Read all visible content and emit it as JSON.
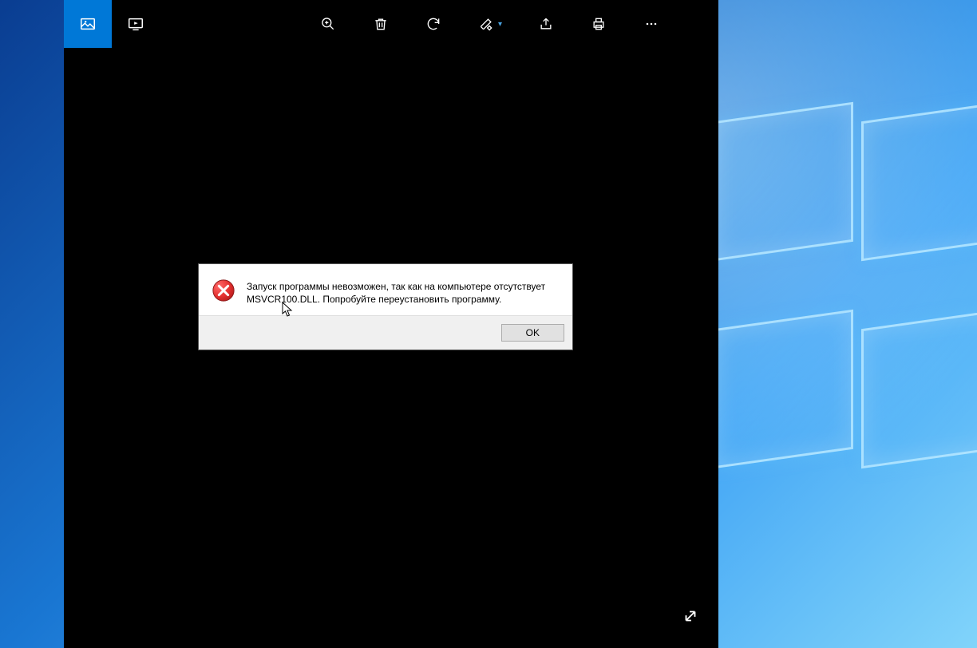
{
  "dialog": {
    "message": "Запуск программы невозможен, так как на компьютере отсутствует MSVCR100.DLL. Попробуйте переустановить программу.",
    "ok_label": "OK"
  },
  "toolbar": {
    "icons": {
      "photo": "photo-icon",
      "slideshow": "slideshow-icon",
      "zoom": "zoom-in-icon",
      "delete": "delete-icon",
      "rotate": "rotate-icon",
      "edit": "edit-draw-icon",
      "share": "share-icon",
      "print": "print-icon",
      "more": "more-icon"
    }
  },
  "colors": {
    "accent": "#0078d7",
    "toolbar_bg": "#000000",
    "dialog_bg": "#ffffff",
    "dialog_footer_bg": "#f0f0f0"
  }
}
